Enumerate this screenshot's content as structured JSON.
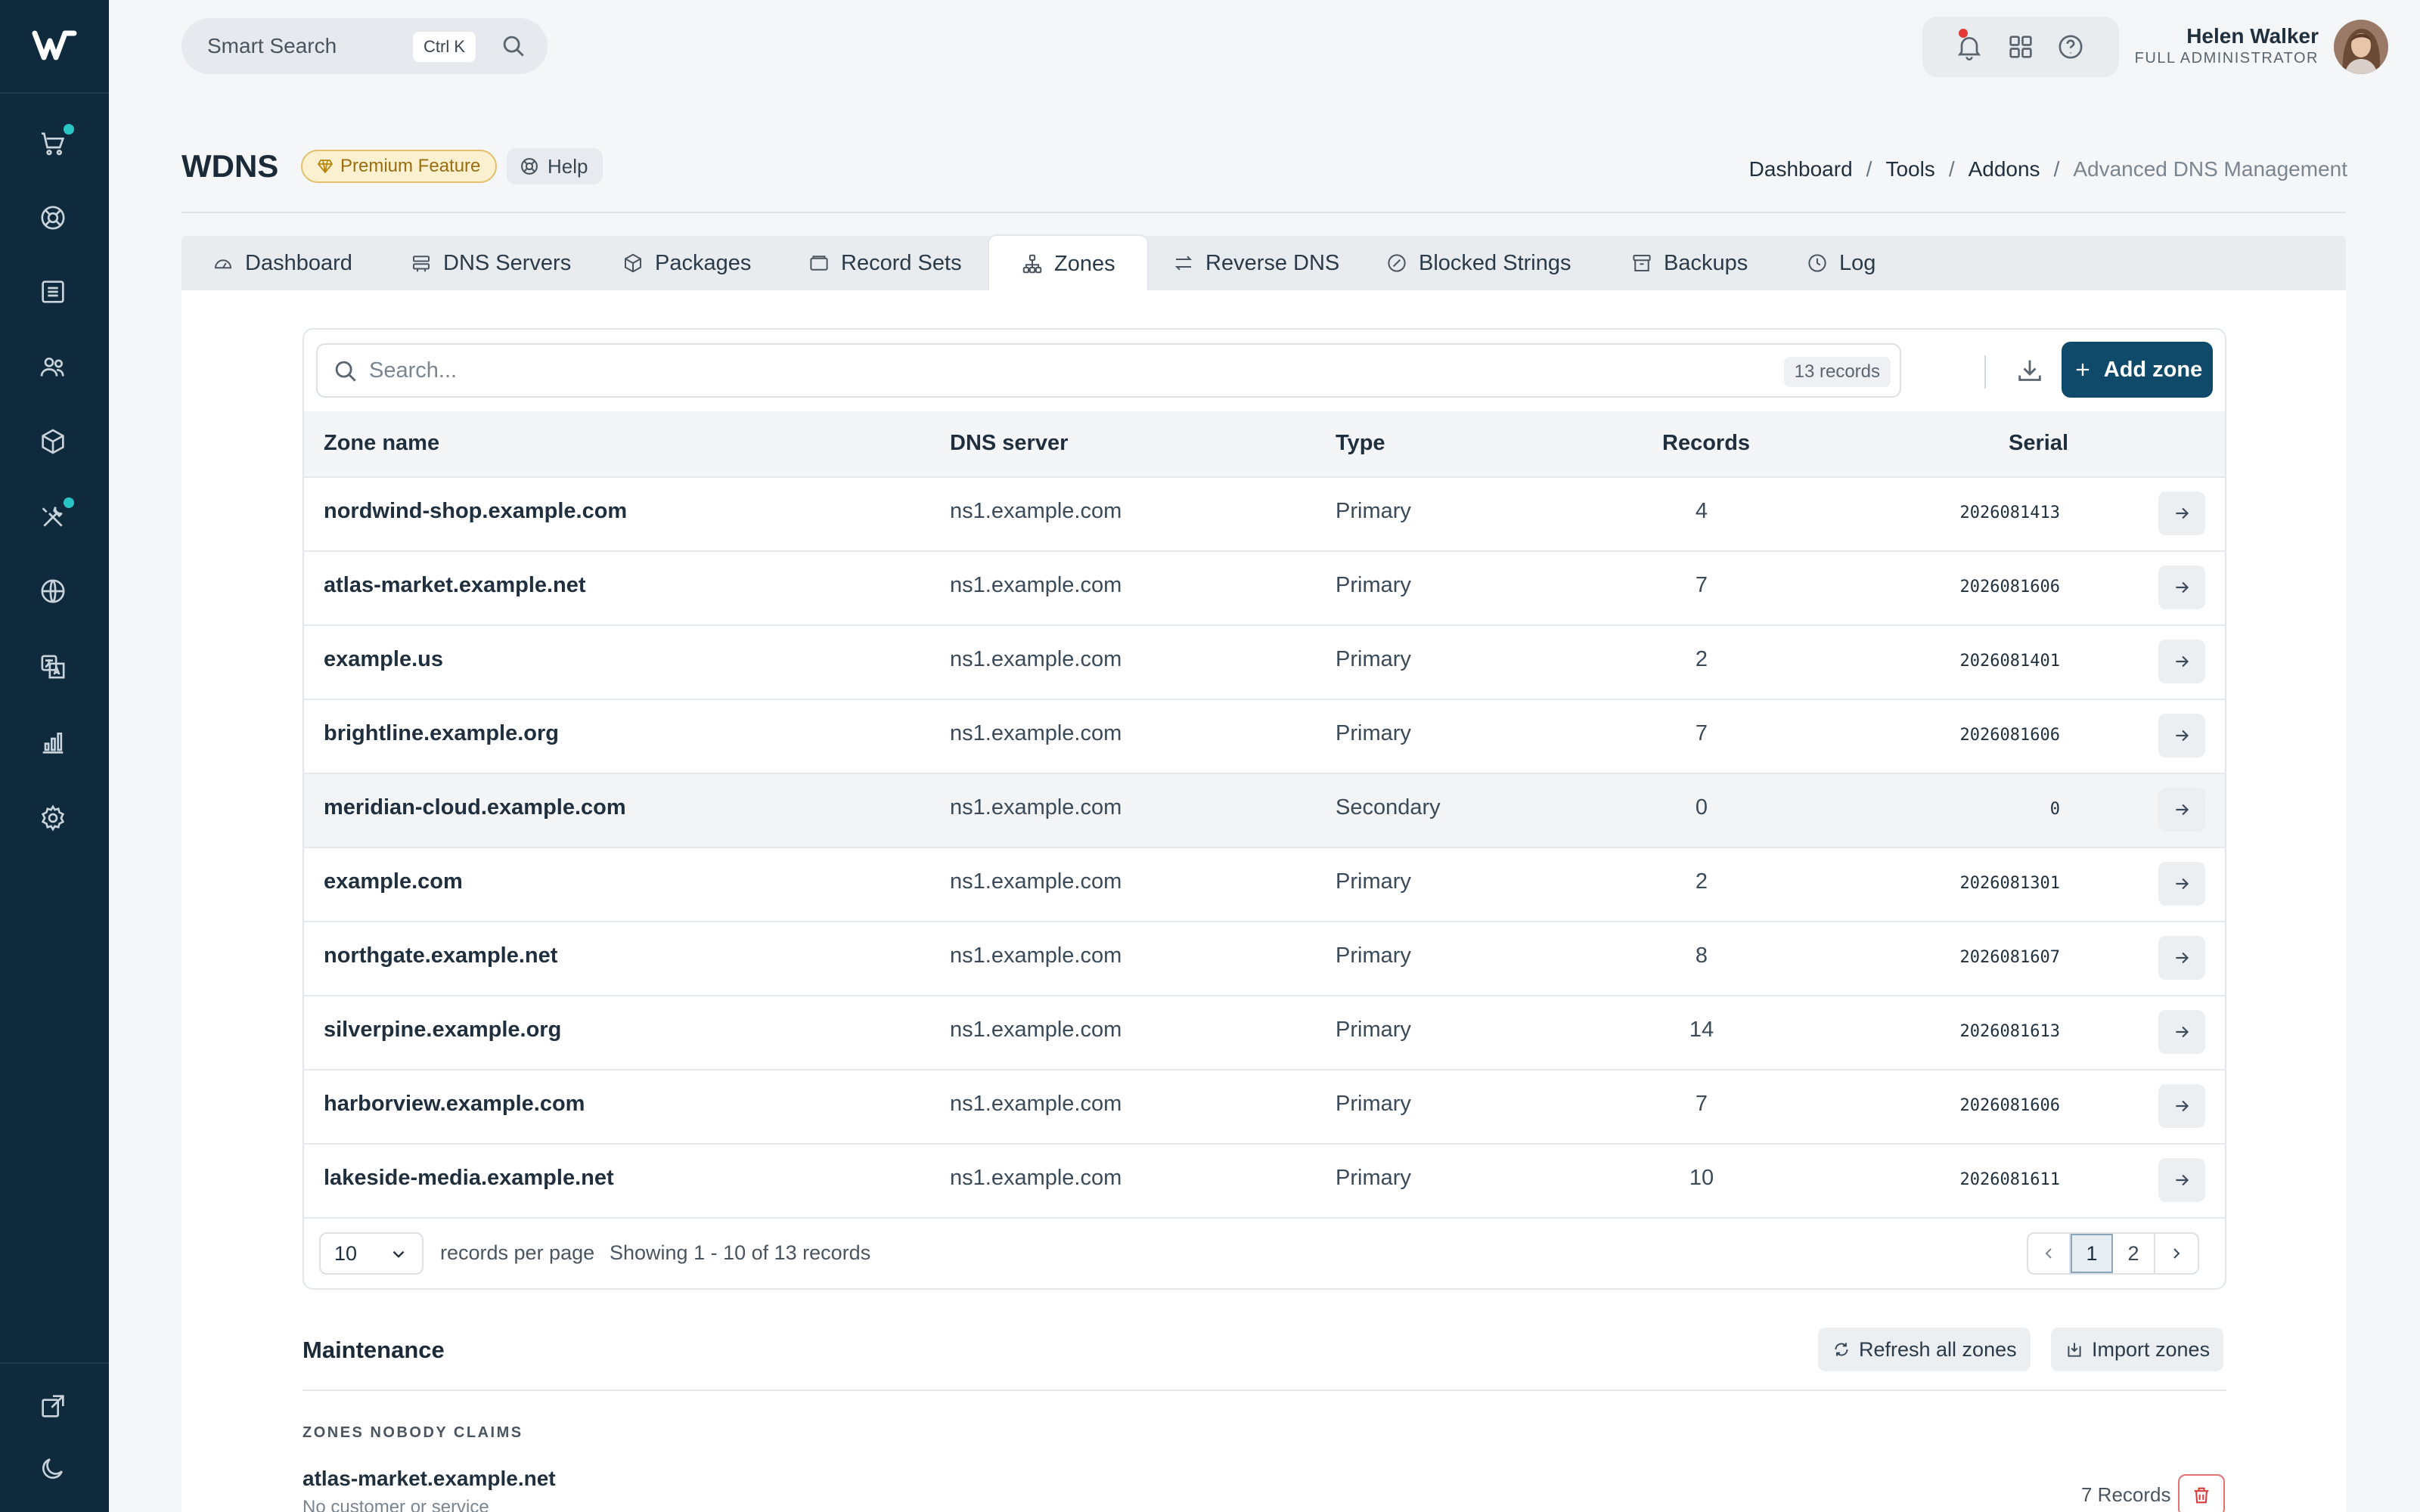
{
  "search": {
    "label": "Smart Search",
    "shortcut": "Ctrl K"
  },
  "user": {
    "name": "Helen Walker",
    "role": "FULL ADMINISTRATOR"
  },
  "page": {
    "title": "WDNS",
    "premium_label": "Premium Feature",
    "help_label": "Help"
  },
  "breadcrumb": [
    "Dashboard",
    "Tools",
    "Addons",
    "Advanced DNS Management"
  ],
  "tabs": [
    {
      "label": "Dashboard",
      "icon": "gauge-icon"
    },
    {
      "label": "DNS Servers",
      "icon": "server-icon"
    },
    {
      "label": "Packages",
      "icon": "package-icon"
    },
    {
      "label": "Record Sets",
      "icon": "folder-icon"
    },
    {
      "label": "Zones",
      "icon": "sitemap-icon"
    },
    {
      "label": "Reverse DNS",
      "icon": "arrows-icon"
    },
    {
      "label": "Blocked Strings",
      "icon": "ban-icon"
    },
    {
      "label": "Backups",
      "icon": "archive-icon"
    },
    {
      "label": "Log",
      "icon": "clock-icon"
    }
  ],
  "active_tab": "Zones",
  "table": {
    "search_placeholder": "Search...",
    "record_count": "13 records",
    "add_label": "Add zone",
    "columns": [
      "Zone name",
      "DNS server",
      "Type",
      "Records",
      "Serial"
    ],
    "rows": [
      {
        "zone": "nordwind-shop.example.com",
        "server": "ns1.example.com",
        "type": "Primary",
        "records": "4",
        "serial": "2026081413"
      },
      {
        "zone": "atlas-market.example.net",
        "server": "ns1.example.com",
        "type": "Primary",
        "records": "7",
        "serial": "2026081606"
      },
      {
        "zone": "example.us",
        "server": "ns1.example.com",
        "type": "Primary",
        "records": "2",
        "serial": "2026081401"
      },
      {
        "zone": "brightline.example.org",
        "server": "ns1.example.com",
        "type": "Primary",
        "records": "7",
        "serial": "2026081606"
      },
      {
        "zone": "meridian-cloud.example.com",
        "server": "ns1.example.com",
        "type": "Secondary",
        "records": "0",
        "serial": "0"
      },
      {
        "zone": "example.com",
        "server": "ns1.example.com",
        "type": "Primary",
        "records": "2",
        "serial": "2026081301"
      },
      {
        "zone": "northgate.example.net",
        "server": "ns1.example.com",
        "type": "Primary",
        "records": "8",
        "serial": "2026081607"
      },
      {
        "zone": "silverpine.example.org",
        "server": "ns1.example.com",
        "type": "Primary",
        "records": "14",
        "serial": "2026081613"
      },
      {
        "zone": "harborview.example.com",
        "server": "ns1.example.com",
        "type": "Primary",
        "records": "7",
        "serial": "2026081606"
      },
      {
        "zone": "lakeside-media.example.net",
        "server": "ns1.example.com",
        "type": "Primary",
        "records": "10",
        "serial": "2026081611"
      }
    ],
    "per_page": "10",
    "per_page_label": "records per page",
    "showing": "Showing 1 - 10 of 13 records",
    "pages": [
      "1",
      "2"
    ]
  },
  "maintenance": {
    "title": "Maintenance",
    "refresh_label": "Refresh all zones",
    "import_label": "Import zones",
    "unclaimed_label": "ZONES NOBODY CLAIMS",
    "unclaimed": {
      "zone": "atlas-market.example.net",
      "sub": "No customer or service",
      "records": "7 Records"
    }
  },
  "colors": {
    "sidebar": "#0f2a3c",
    "accent": "#0f4a6a",
    "premium_bg": "#fbf0cf",
    "notify_dot": "#e53935",
    "status_dot": "#2bc4c4"
  }
}
